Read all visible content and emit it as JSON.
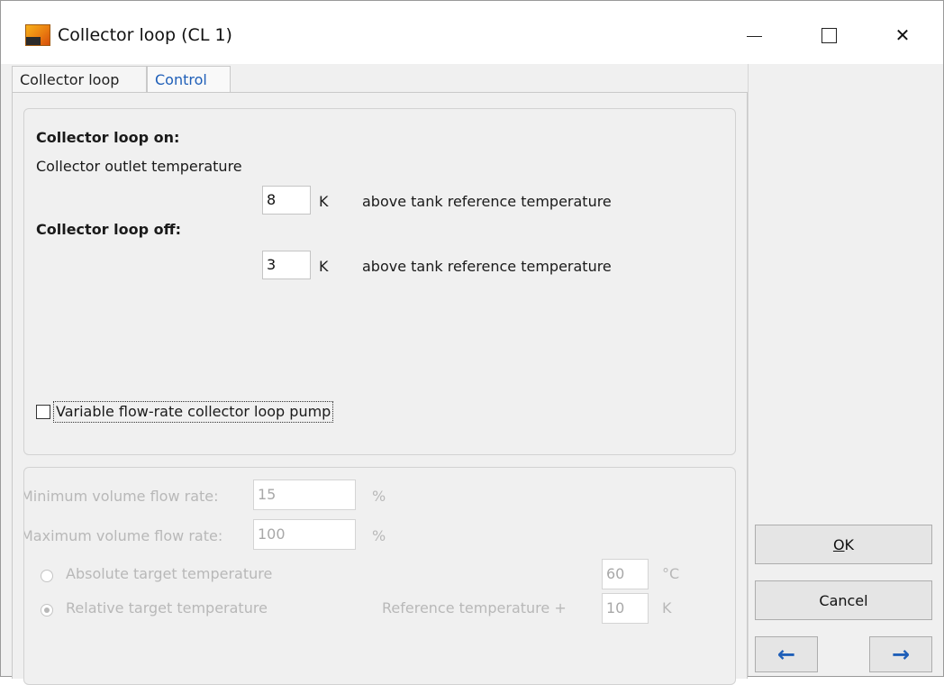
{
  "window": {
    "title": "Collector loop  (CL 1)",
    "controls": {
      "minimize": "—",
      "maximize": "",
      "close": "✕"
    }
  },
  "tabs": [
    {
      "label": "Collector loop"
    },
    {
      "label": "Control"
    }
  ],
  "control": {
    "loop_on_heading": "Collector loop on:",
    "outlet_temp_label": "Collector outlet temperature",
    "on_value": "8",
    "on_unit": "K",
    "on_desc": "above tank reference temperature",
    "loop_off_heading": "Collector loop off:",
    "off_value": "3",
    "off_unit": "K",
    "off_desc": "above tank reference temperature",
    "variable_pump_label": "Variable flow-rate collector loop pump",
    "variable_pump_checked": false
  },
  "flow": {
    "min_label": "Minimum volume flow rate:",
    "min_value": "15",
    "min_unit": "%",
    "max_label": "Maximum volume flow rate:",
    "max_value": "100",
    "max_unit": "%",
    "absolute_label": "Absolute target temperature",
    "absolute_value": "60",
    "absolute_unit": "°C",
    "relative_label": "Relative target temperature",
    "reference_label": "Reference temperature +",
    "relative_value": "10",
    "relative_unit": "K",
    "selected_mode": "relative"
  },
  "buttons": {
    "ok_mnemonic": "O",
    "ok_rest": "K",
    "cancel": "Cancel",
    "back_icon": "left-arrow-icon",
    "forward_icon": "right-arrow-icon"
  },
  "colors": {
    "accent": "#1f5fb8",
    "disabled_text": "#b8b8b8"
  }
}
